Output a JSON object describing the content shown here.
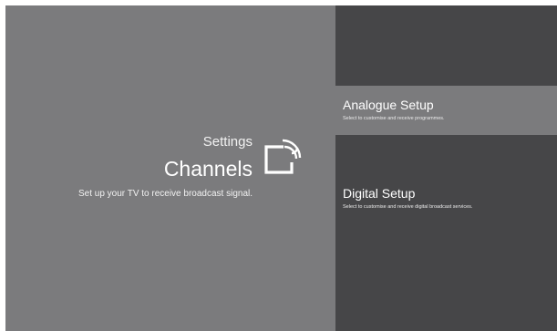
{
  "colors": {
    "left_panel": "#7b7b7d",
    "right_panel": "#464648",
    "highlight": "#7b7b7d",
    "text": "#ffffff"
  },
  "header": {
    "section": "Settings",
    "title": "Channels",
    "description": "Set up your TV to receive broadcast signal.",
    "icon": "broadcast-channel-icon"
  },
  "menu": {
    "items": [
      {
        "title": "Analogue Setup",
        "description": "Select to customise and receive programmes.",
        "selected": true
      },
      {
        "title": "Digital Setup",
        "description": "Select to customise and receive digital broadcast services.",
        "selected": false
      }
    ]
  }
}
